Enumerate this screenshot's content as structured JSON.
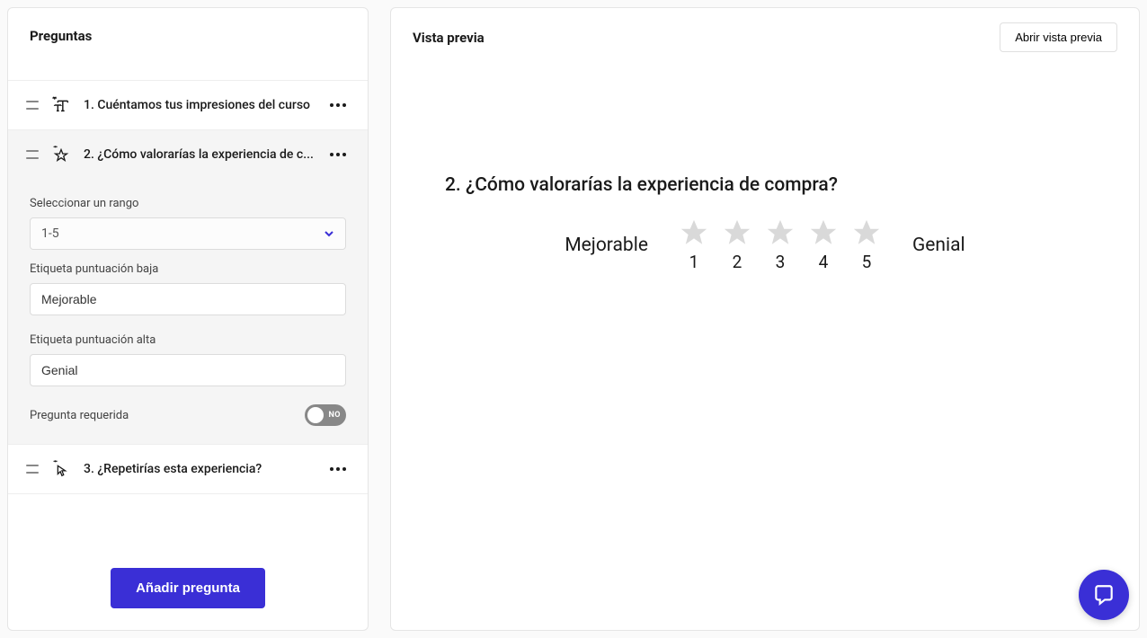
{
  "questions": {
    "header": "Preguntas",
    "items": [
      {
        "title": "1. Cuéntamos tus impresiones del curso"
      },
      {
        "title": "2. ¿Cómo valorarías la experiencia de c..."
      },
      {
        "title": "3. ¿Repetirías esta experiencia?"
      }
    ],
    "add_label": "Añadir pregunta"
  },
  "editor": {
    "range_label": "Seleccionar un rango",
    "range_value": "1-5",
    "low_label_label": "Etiqueta puntuación baja",
    "low_label_value": "Mejorable",
    "high_label_label": "Etiqueta puntuación alta",
    "high_label_value": "Genial",
    "required_label": "Pregunta requerida",
    "required_toggle": "NO"
  },
  "preview": {
    "header": "Vista previa",
    "open_button": "Abrir vista previa",
    "question": "2.  ¿Cómo valorarías la experiencia de compra?",
    "low": "Mejorable",
    "high": "Genial",
    "nums": [
      "1",
      "2",
      "3",
      "4",
      "5"
    ]
  }
}
